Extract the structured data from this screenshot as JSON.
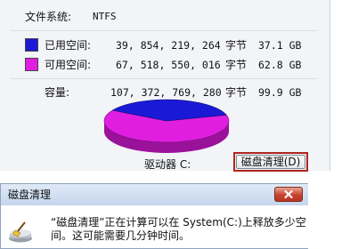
{
  "properties": {
    "filesystem_label": "文件系统:",
    "filesystem_value": "NTFS",
    "used": {
      "label": "已用空间:",
      "bytes": "39, 854, 219, 264",
      "unit": "字节",
      "size": "37.1 GB",
      "color": "#1a1ad6"
    },
    "free": {
      "label": "可用空间:",
      "bytes": "67, 518, 550, 016",
      "unit": "字节",
      "size": "62.8 GB",
      "color": "#e01ee0"
    },
    "capacity": {
      "label": "容量:",
      "bytes": "107, 372, 769, 280",
      "unit": "字节",
      "size": "99.9 GB"
    },
    "drive_label": "驱动器 C:",
    "clean_button_label": "磁盘清理(D)",
    "used_fraction": 0.371
  },
  "dialog": {
    "title": "磁盘清理",
    "message": "“磁盘清理”正在计算可以在 System(C:)上释放多少空间。这可能需要几分钟时间。"
  }
}
